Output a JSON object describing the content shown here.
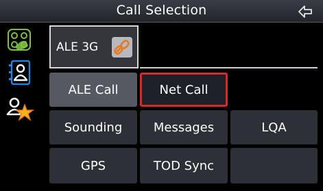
{
  "header": {
    "title": "Call Selection"
  },
  "radio": {
    "name": "ALE 3G"
  },
  "tiles": {
    "ale_call": "ALE Call",
    "net_call": "Net Call",
    "sounding": "Sounding",
    "messages": "Messages",
    "lqa": "LQA",
    "gps": "GPS",
    "tod_sync": "TOD Sync"
  },
  "icons": {
    "back": "back-arrow-icon",
    "sidebar": [
      "network-hand-icon",
      "contact-card-icon",
      "favorite-contact-icon"
    ],
    "link": "link-icon"
  },
  "colors": {
    "accent_green": "#7dc242",
    "accent_blue": "#1e88e5",
    "accent_orange": "#e8791f",
    "focus_red": "#d42a2a",
    "star_yellow": "#f6b21a"
  }
}
